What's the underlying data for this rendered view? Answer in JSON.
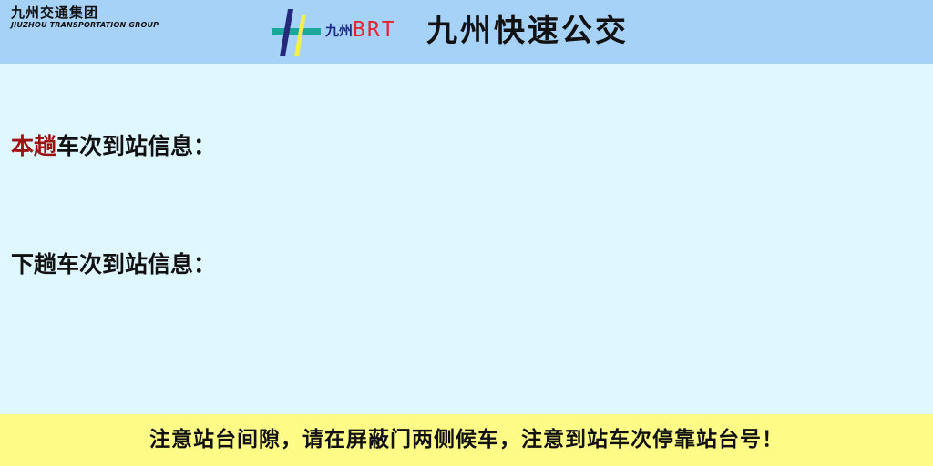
{
  "header": {
    "company_name_cn": "九州交通集团",
    "company_name_en": "JIUZHOU TRANSPORTATION GROUP",
    "logo": {
      "brand_cn": "九州",
      "brand_en": "BRT",
      "icon": "brt-hash-logo-icon",
      "colors": {
        "teal": "#1aa89a",
        "navy": "#25297a",
        "yellow": "#f0f04a",
        "red": "#e8232e"
      }
    },
    "title": "九州快速公交"
  },
  "main": {
    "current_trip": {
      "highlight": "本趟",
      "label": "车次到站信息："
    },
    "next_trip": {
      "label": "下趟车次到站信息："
    }
  },
  "footer": {
    "notice": "注意站台间隙，请在屏蔽门两侧候车，注意到站车次停靠站台号！"
  },
  "colors": {
    "header_bg": "#a6d2f8",
    "body_bg": "#dff8ff",
    "footer_bg": "#fffb87",
    "highlight_text": "#a01010"
  }
}
